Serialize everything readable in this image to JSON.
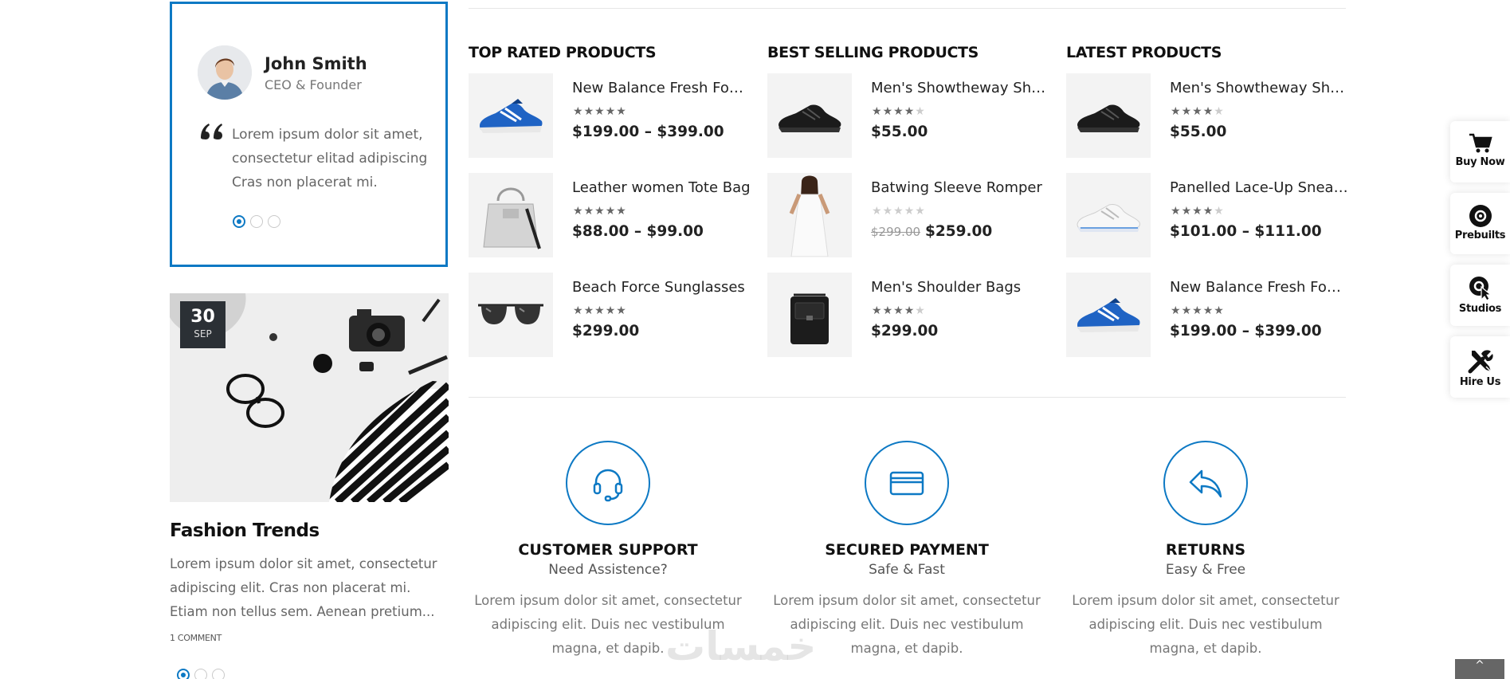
{
  "testimonial": {
    "name": "John Smith",
    "role": "CEO & Founder",
    "text": "Lorem ipsum dolor sit amet, consectetur elitad adipiscing Cras non placerat mi.",
    "avatar_icon": "person-avatar"
  },
  "blog": {
    "day": "30",
    "month": "SEP",
    "title": "Fashion Trends",
    "excerpt": "Lorem ipsum dolor sit amet, consectetur adipiscing elit. Cras non placerat mi. Etiam non tellus sem. Aenean pretium...",
    "comments": "1 COMMENT"
  },
  "product_columns": [
    {
      "title": "TOP RATED PRODUCTS",
      "products": [
        {
          "name": "New Balance Fresh Foam...",
          "price": "$199.00 – $399.00",
          "old_price": "",
          "rating": 5,
          "thumb": "blue-sneaker-icon"
        },
        {
          "name": "Leather women Tote Bag",
          "price": "$88.00 – $99.00",
          "old_price": "",
          "rating": 5,
          "thumb": "tote-bag-icon"
        },
        {
          "name": "Beach Force Sunglasses",
          "price": "$299.00",
          "old_price": "",
          "rating": 5,
          "thumb": "sunglasses-icon"
        }
      ]
    },
    {
      "title": "BEST SELLING PRODUCTS",
      "products": [
        {
          "name": "Men's Showtheway Shoes",
          "price": "$55.00",
          "old_price": "",
          "rating": 4,
          "thumb": "black-sneaker-icon"
        },
        {
          "name": "Batwing Sleeve Romper",
          "price": "$259.00",
          "old_price": "$299.00",
          "rating": 0,
          "thumb": "dress-model-icon"
        },
        {
          "name": "Men's Shoulder Bags",
          "price": "$299.00",
          "old_price": "",
          "rating": 4,
          "thumb": "shoulder-bag-icon"
        }
      ]
    },
    {
      "title": "LATEST PRODUCTS",
      "products": [
        {
          "name": "Men's Showtheway Shoes",
          "price": "$55.00",
          "old_price": "",
          "rating": 4,
          "thumb": "black-sneaker-icon"
        },
        {
          "name": "Panelled Lace-Up Sneakers",
          "price": "$101.00 – $111.00",
          "old_price": "",
          "rating": 4,
          "thumb": "white-sneaker-icon"
        },
        {
          "name": "New Balance Fresh Foam...",
          "price": "$199.00 – $399.00",
          "old_price": "",
          "rating": 5,
          "thumb": "blue-sneaker-icon"
        }
      ]
    }
  ],
  "features": [
    {
      "title": "CUSTOMER SUPPORT",
      "subtitle": "Need Assistence?",
      "text": "Lorem ipsum dolor sit amet, consectetur adipiscing elit. Duis nec vestibulum magna, et dapib.",
      "icon": "headset-icon"
    },
    {
      "title": "SECURED PAYMENT",
      "subtitle": "Safe & Fast",
      "text": "Lorem ipsum dolor sit amet, consectetur adipiscing elit. Duis nec vestibulum magna, et dapib.",
      "icon": "credit-card-icon"
    },
    {
      "title": "RETURNS",
      "subtitle": "Easy & Free",
      "text": "Lorem ipsum dolor sit amet, consectetur adipiscing elit. Duis nec vestibulum magna, et dapib.",
      "icon": "reply-arrow-icon"
    }
  ],
  "side_panel": [
    {
      "label": "Buy Now",
      "icon": "cart-icon"
    },
    {
      "label": "Prebuilts",
      "icon": "disc-icon"
    },
    {
      "label": "Studios",
      "icon": "pointer-icon"
    },
    {
      "label": "Hire Us",
      "icon": "tools-icon"
    }
  ],
  "watermark": "خمسات",
  "colors": {
    "accent": "#0d79c4",
    "text_dark": "#222222",
    "text_muted": "#777777",
    "badge_bg": "#2b3035"
  }
}
